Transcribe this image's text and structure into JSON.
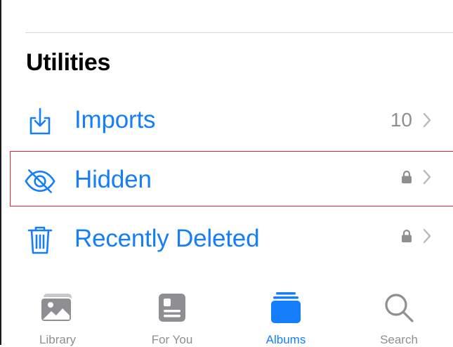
{
  "section": {
    "title": "Utilities"
  },
  "rows": [
    {
      "label": "Imports",
      "count": "10",
      "icon": "import-icon",
      "locked": false
    },
    {
      "label": "Hidden",
      "count": "",
      "icon": "eye-slash-icon",
      "locked": true
    },
    {
      "label": "Recently Deleted",
      "count": "",
      "icon": "trash-icon",
      "locked": true
    }
  ],
  "tabs": [
    {
      "label": "Library",
      "icon": "library-icon",
      "active": false
    },
    {
      "label": "For You",
      "icon": "for-you-icon",
      "active": false
    },
    {
      "label": "Albums",
      "icon": "albums-icon",
      "active": true
    },
    {
      "label": "Search",
      "icon": "search-icon",
      "active": false
    }
  ],
  "colors": {
    "accent": "#157efb",
    "secondary": "#8e8e93",
    "highlight": "#e8202a"
  }
}
